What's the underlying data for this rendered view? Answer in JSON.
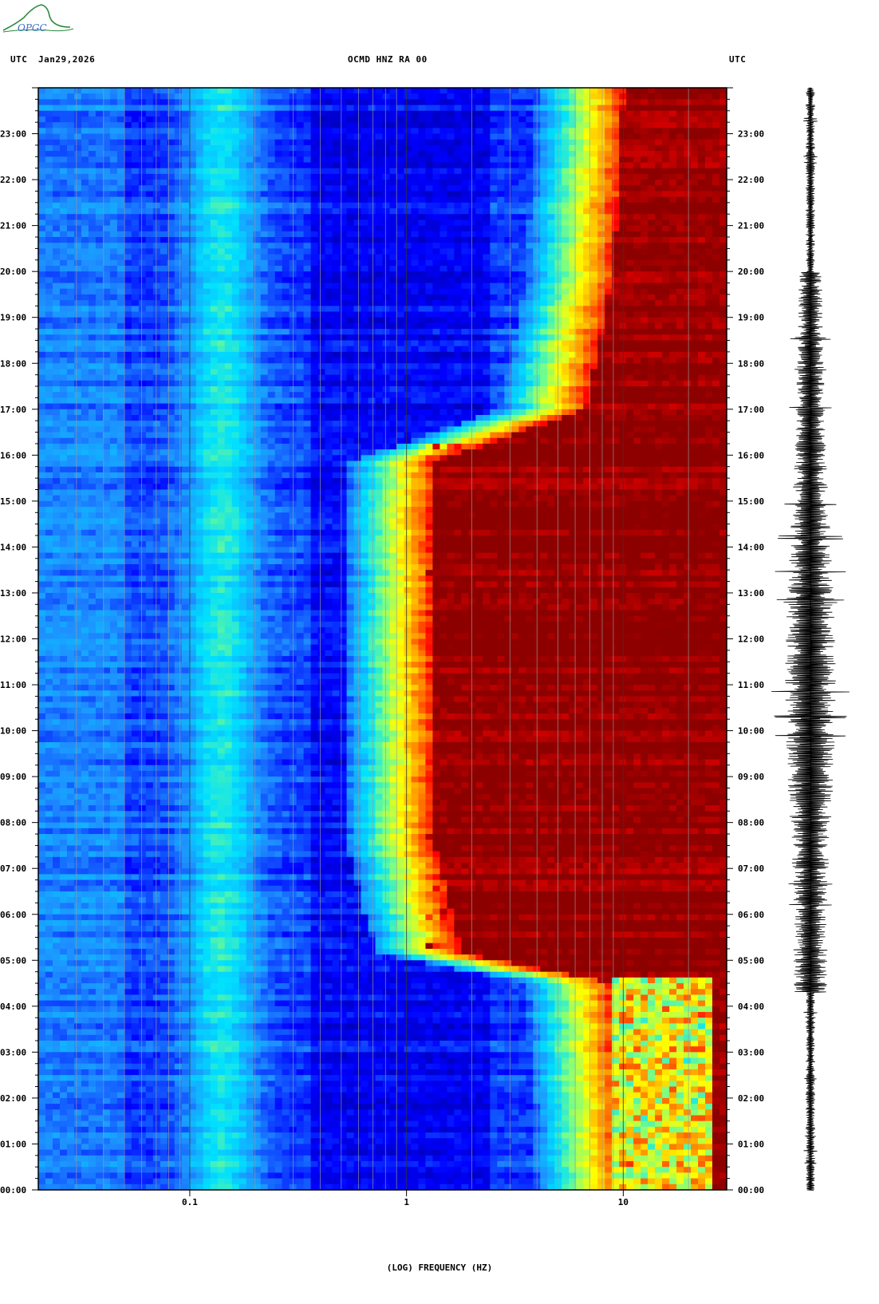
{
  "header": {
    "left_tz": "UTC",
    "date": "Jan29,2026",
    "station": "OCMD HNZ RA 00",
    "right_tz": "UTC"
  },
  "logo": {
    "text": "OPGC"
  },
  "chart_data": {
    "type": "heatmap",
    "title": "OCMD HNZ RA 00",
    "xlabel": "(LOG) FREQUENCY (HZ)",
    "xscale": "log",
    "xlim": [
      0.02,
      30
    ],
    "xticks": [
      {
        "value": 0.1,
        "label": "0.1"
      },
      {
        "value": 1,
        "label": "1"
      },
      {
        "value": 10,
        "label": "10"
      }
    ],
    "ylabel": "UTC",
    "ylim": [
      "00:00",
      "24:00"
    ],
    "yticks": [
      "00:00",
      "01:00",
      "02:00",
      "03:00",
      "04:00",
      "05:00",
      "06:00",
      "07:00",
      "08:00",
      "09:00",
      "10:00",
      "11:00",
      "12:00",
      "13:00",
      "14:00",
      "15:00",
      "16:00",
      "17:00",
      "18:00",
      "19:00",
      "20:00",
      "21:00",
      "22:00",
      "23:00"
    ],
    "colormap": [
      "#00008b",
      "#0000ff",
      "#1e90ff",
      "#00e0ff",
      "#7fff7f",
      "#ffff00",
      "#ff8c00",
      "#ff0000",
      "#8b0000"
    ],
    "high_energy_onset_hz": [
      {
        "time": "00:00",
        "hz": 9
      },
      {
        "time": "04:30",
        "hz": 8
      },
      {
        "time": "05:10",
        "hz": 1.6
      },
      {
        "time": "07:30",
        "hz": 1.2
      },
      {
        "time": "09:30",
        "hz": 1.2
      },
      {
        "time": "12:00",
        "hz": 1.2
      },
      {
        "time": "15:50",
        "hz": 1.2
      },
      {
        "time": "17:00",
        "hz": 6
      },
      {
        "time": "20:00",
        "hz": 8
      },
      {
        "time": "24:00",
        "hz": 9
      }
    ],
    "seismogram": {
      "trace": "HNZ",
      "peak_activity": [
        "07:00",
        "17:00"
      ]
    }
  }
}
